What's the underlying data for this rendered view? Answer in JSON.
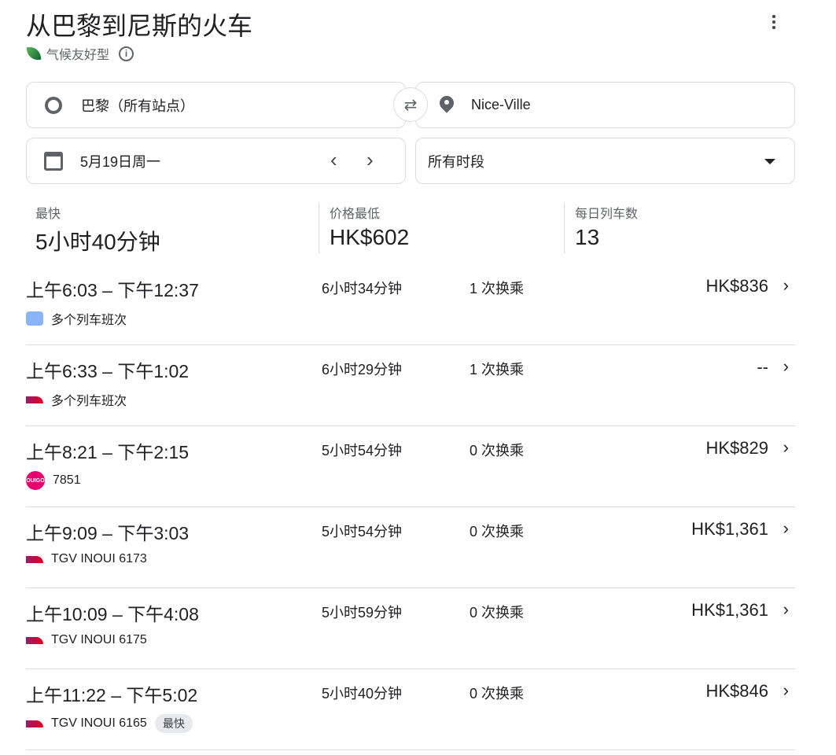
{
  "title": "从巴黎到尼斯的火车",
  "eco_label": "气候友好型",
  "origin": "巴黎（所有站点）",
  "destination": "Nice-Ville",
  "date": "5月19日周一",
  "time_filter": "所有时段",
  "stats": [
    {
      "label": "最快",
      "value": "5小时40分钟"
    },
    {
      "label": "价格最低",
      "value": "HK$602"
    },
    {
      "label": "每日列车数",
      "value": "13"
    }
  ],
  "rows": [
    {
      "time": "上午6:03 – 下午12:37",
      "duration": "6小时34分钟",
      "transfers": "1 次换乘",
      "price": "HK$836",
      "carrier": "多个列车班次",
      "icon": "bus"
    },
    {
      "time": "上午6:33 – 下午1:02",
      "duration": "6小时29分钟",
      "transfers": "1 次换乘",
      "price": "--",
      "carrier": "多个列车班次",
      "icon": "tgv"
    },
    {
      "time": "上午8:21 – 下午2:15",
      "duration": "5小时54分钟",
      "transfers": "0 次换乘",
      "price": "HK$829",
      "carrier": "7851",
      "icon": "ouigo"
    },
    {
      "time": "上午9:09 – 下午3:03",
      "duration": "5小时54分钟",
      "transfers": "0 次换乘",
      "price": "HK$1,361",
      "carrier": "TGV INOUI 6173",
      "icon": "tgv"
    },
    {
      "time": "上午10:09 – 下午4:08",
      "duration": "5小时59分钟",
      "transfers": "0 次换乘",
      "price": "HK$1,361",
      "carrier": "TGV INOUI 6175",
      "icon": "tgv"
    },
    {
      "time": "上午11:22 – 下午5:02",
      "duration": "5小时40分钟",
      "transfers": "0 次换乘",
      "price": "HK$846",
      "carrier": "TGV INOUI 6165",
      "icon": "tgv",
      "badge": "最快"
    }
  ],
  "ouigo_logo": "OUIGO"
}
